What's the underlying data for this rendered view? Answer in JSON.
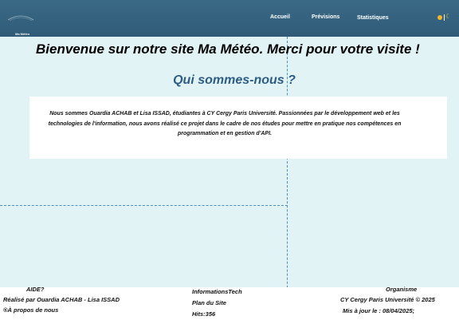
{
  "header": {
    "logo_text": "Ma Météo",
    "nav": {
      "home": "Accueil",
      "forecast": "Prévisions",
      "stats": "Statistiques"
    },
    "theme_toggle_icons": [
      "sun-icon",
      "moon-icon"
    ],
    "moon_glyph": "☾",
    "colors": {
      "bar": "#2f5b78",
      "sun": "#f4b32a"
    }
  },
  "main": {
    "welcome": "Bienvenue sur notre site Ma Météo. Merci pour votre visite !",
    "about_title": "Qui sommes-nous ?",
    "about_text": "Nous sommes Ouardia ACHAB et Lisa ISSAD, étudiantes à CY Cergy Paris Université. Passionnées par le développement web et les technologies de l'information, nous avons réalisé ce projet dans le cadre de nos études pour mettre en pratique nos compétences en programmation et en gestion d'API."
  },
  "footer": {
    "help": {
      "title": "AIDE?",
      "credit": "Réalisé par Ouardia ACHAB - Lisa ISSAD",
      "about_link": "®À propos de nous"
    },
    "info": {
      "title": "InformationsTech",
      "plan": "Plan du Site",
      "hits": "Hits:356"
    },
    "org": {
      "title": "Organisme",
      "copyright": "CY Cergy Paris Université © 2025",
      "updated": "Mis à jour le : 08/04/2025;"
    }
  }
}
